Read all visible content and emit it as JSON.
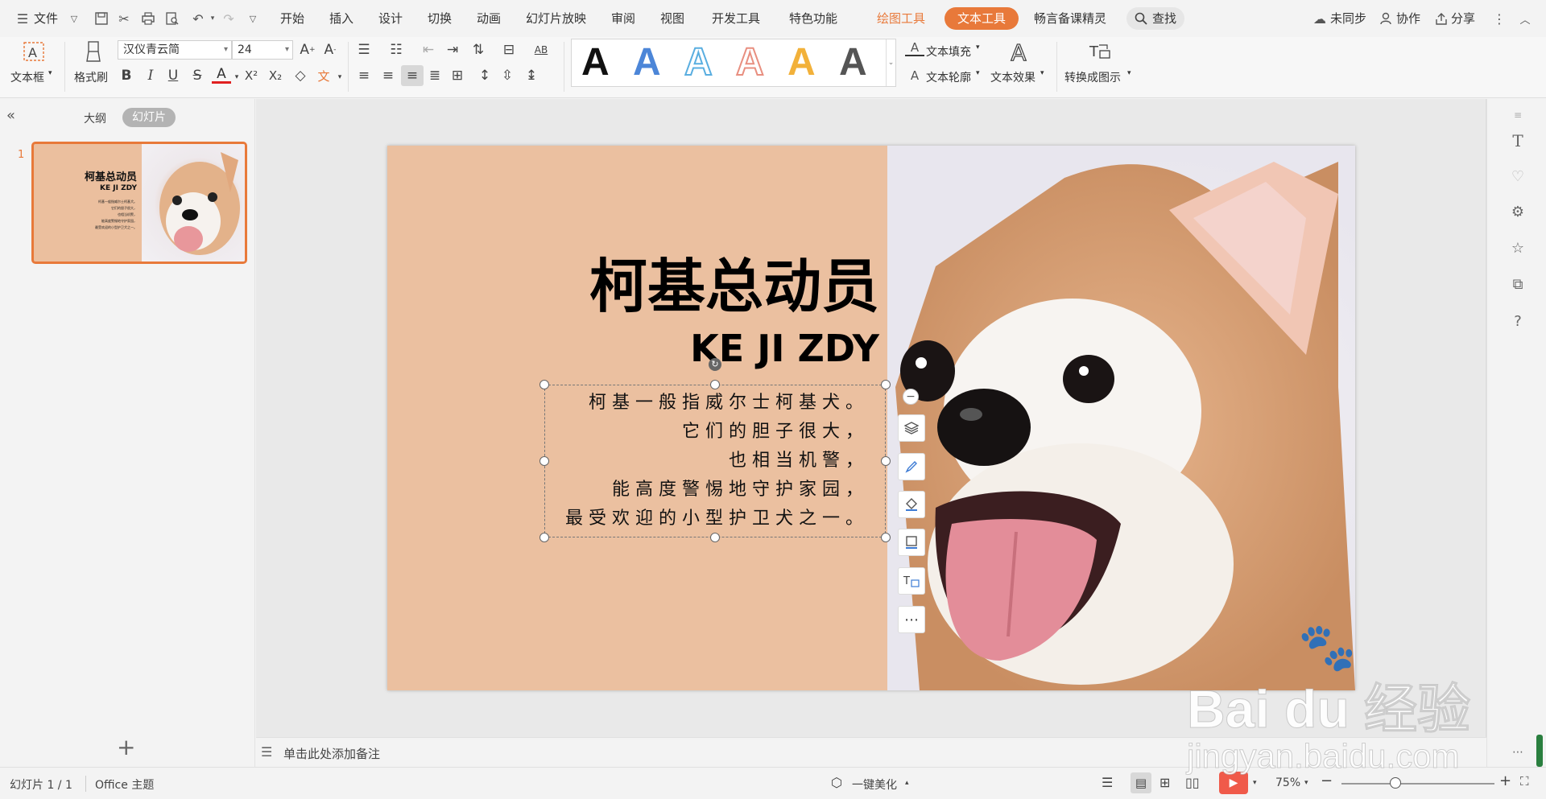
{
  "menubar": {
    "file": "文件",
    "tabs": [
      "开始",
      "插入",
      "设计",
      "切换",
      "动画",
      "幻灯片放映",
      "审阅",
      "视图",
      "开发工具",
      "特色功能"
    ],
    "drawing_tools": "绘图工具",
    "text_tools": "文本工具",
    "extra": "畅言备课精灵",
    "search": "查找",
    "sync": "未同步",
    "collab": "协作",
    "share": "分享",
    "accent": "#e8793a"
  },
  "ribbon": {
    "textbox": "文本框",
    "format_painter": "格式刷",
    "font_name": "汉仪青云简",
    "font_size": "24",
    "text_fill": "文本填充",
    "text_outline": "文本轮廓",
    "text_effect": "文本效果",
    "convert": "转换成图示",
    "gallery_letter": "A"
  },
  "leftpanel": {
    "outline_tab": "大纲",
    "slides_tab": "幻灯片",
    "slide_number": "1",
    "add_icon": "plus-icon"
  },
  "slide": {
    "title": "柯基总动员",
    "subtitle": "KE JI ZDY",
    "lines": [
      "柯基一般指威尔士柯基犬。",
      "它们的胆子很大，",
      "也相当机警，",
      "能高度警惕地守护家园，",
      "最受欢迎的小型护卫犬之一。"
    ],
    "bg_color": "#ebc0a0"
  },
  "notes": {
    "placeholder": "单击此处添加备注"
  },
  "statusbar": {
    "slide_info": "幻灯片 1 / 1",
    "theme": "Office 主题",
    "beautify": "一键美化",
    "zoom": "75%",
    "zoom_level": 0.35
  },
  "watermark": {
    "brand": "Bai du 经验",
    "url": "jingyan.baidu.com"
  }
}
